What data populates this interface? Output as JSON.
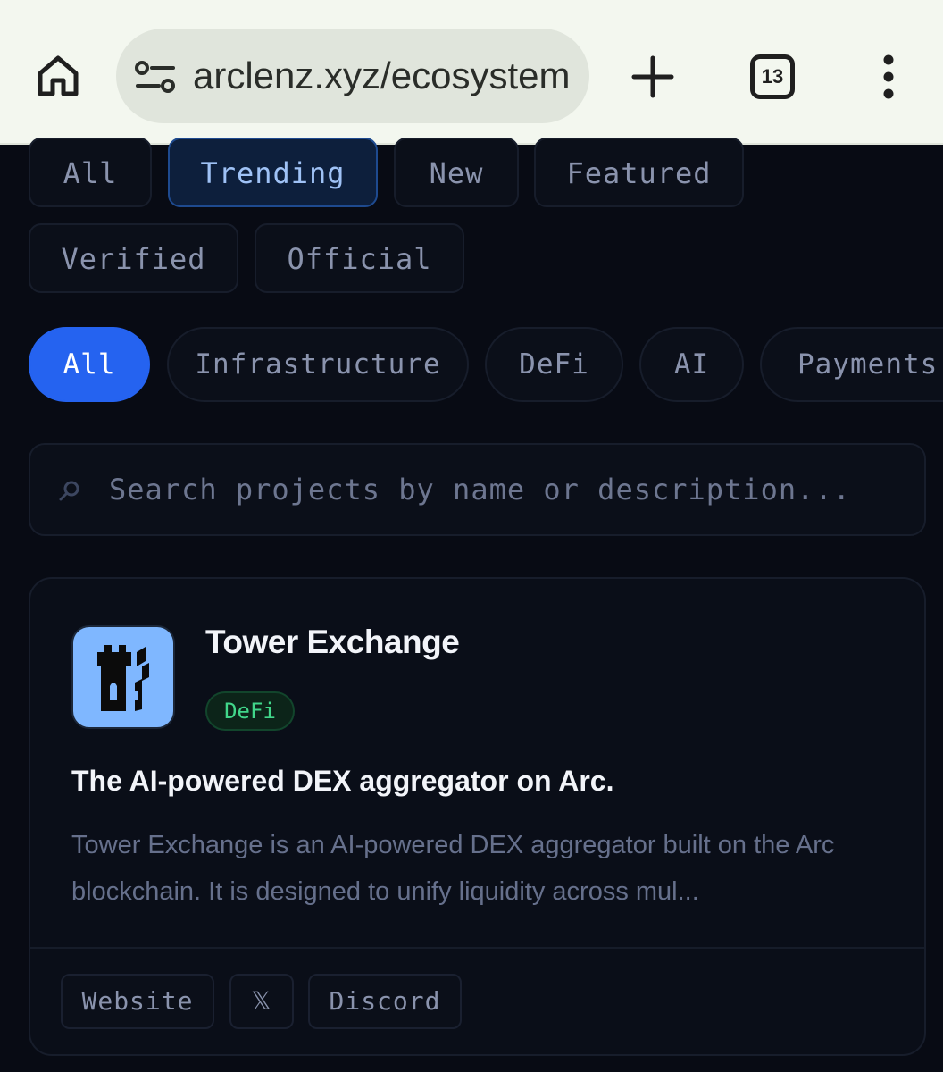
{
  "browser": {
    "url": "arclenz.xyz/ecosystem",
    "tab_count": "13"
  },
  "filters": {
    "sort_chips": [
      {
        "label": "All",
        "active": false
      },
      {
        "label": "Trending",
        "active": true
      },
      {
        "label": "New",
        "active": false
      },
      {
        "label": "Featured",
        "active": false
      },
      {
        "label": "Verified",
        "active": false
      },
      {
        "label": "Official",
        "active": false
      }
    ],
    "category_pills": [
      {
        "label": "All",
        "active": true
      },
      {
        "label": "Infrastructure",
        "active": false
      },
      {
        "label": "DeFi",
        "active": false
      },
      {
        "label": "AI",
        "active": false
      },
      {
        "label": "Payments",
        "active": false
      }
    ]
  },
  "search": {
    "placeholder": "Search projects by name or description...",
    "value": ""
  },
  "project_card": {
    "name": "Tower Exchange",
    "category": "DeFi",
    "tagline": "The AI-powered DEX aggregator on Arc.",
    "description": "Tower Exchange is an AI-powered DEX aggregator built on the Arc blockchain. It is designed to unify liquidity across mul...",
    "links": {
      "website": "Website",
      "x": "𝕏",
      "discord": "Discord"
    }
  },
  "colors": {
    "accent": "#2563f0",
    "background": "#080b14",
    "defi_badge": "#41d68a",
    "logo_bg": "#7fb7ff"
  }
}
